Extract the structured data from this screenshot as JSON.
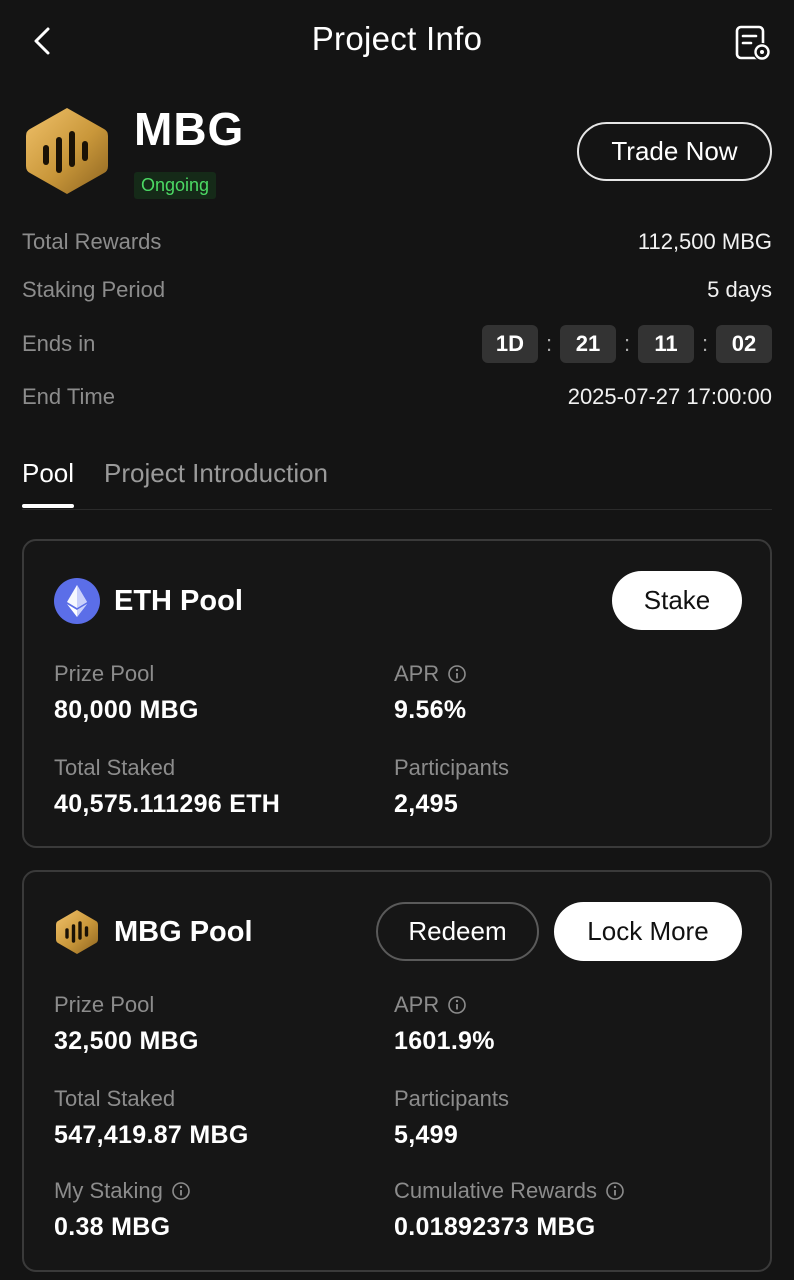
{
  "header": {
    "title": "Project Info",
    "icons": {
      "back": "chevron-left-icon",
      "settings": "document-gear-icon"
    }
  },
  "project": {
    "name": "MBG",
    "status": "Ongoing",
    "trade_label": "Trade Now",
    "brand_color": "#c9973a",
    "status_color": "#4cd964"
  },
  "info": {
    "total_rewards_label": "Total Rewards",
    "total_rewards": "112,500 MBG",
    "staking_period_label": "Staking Period",
    "staking_period": "5 days",
    "ends_in_label": "Ends in",
    "ends_days": "1D",
    "ends_hours": "21",
    "ends_minutes": "11",
    "ends_seconds": "02",
    "sep": ":",
    "end_time_label": "End Time",
    "end_time": "2025-07-27 17:00:00"
  },
  "tabs": [
    {
      "label": "Pool",
      "active": true
    },
    {
      "label": "Project Introduction",
      "active": false
    }
  ],
  "eth_pool": {
    "title": "ETH Pool",
    "stake_label": "Stake",
    "icon_color": "#5b6ee8",
    "prize_pool_label": "Prize Pool",
    "prize_pool": "80,000 MBG",
    "apr_label": "APR",
    "apr": "9.56%",
    "total_staked_label": "Total Staked",
    "total_staked": "40,575.111296 ETH",
    "participants_label": "Participants",
    "participants": "2,495"
  },
  "mbg_pool": {
    "title": "MBG Pool",
    "redeem_label": "Redeem",
    "lock_more_label": "Lock More",
    "prize_pool_label": "Prize Pool",
    "prize_pool": "32,500 MBG",
    "apr_label": "APR",
    "apr": "1601.9%",
    "total_staked_label": "Total Staked",
    "total_staked": "547,419.87 MBG",
    "participants_label": "Participants",
    "participants": "5,499",
    "my_staking_label": "My Staking",
    "my_staking": "0.38 MBG",
    "cumulative_rewards_label": "Cumulative Rewards",
    "cumulative_rewards": "0.01892373 MBG"
  }
}
